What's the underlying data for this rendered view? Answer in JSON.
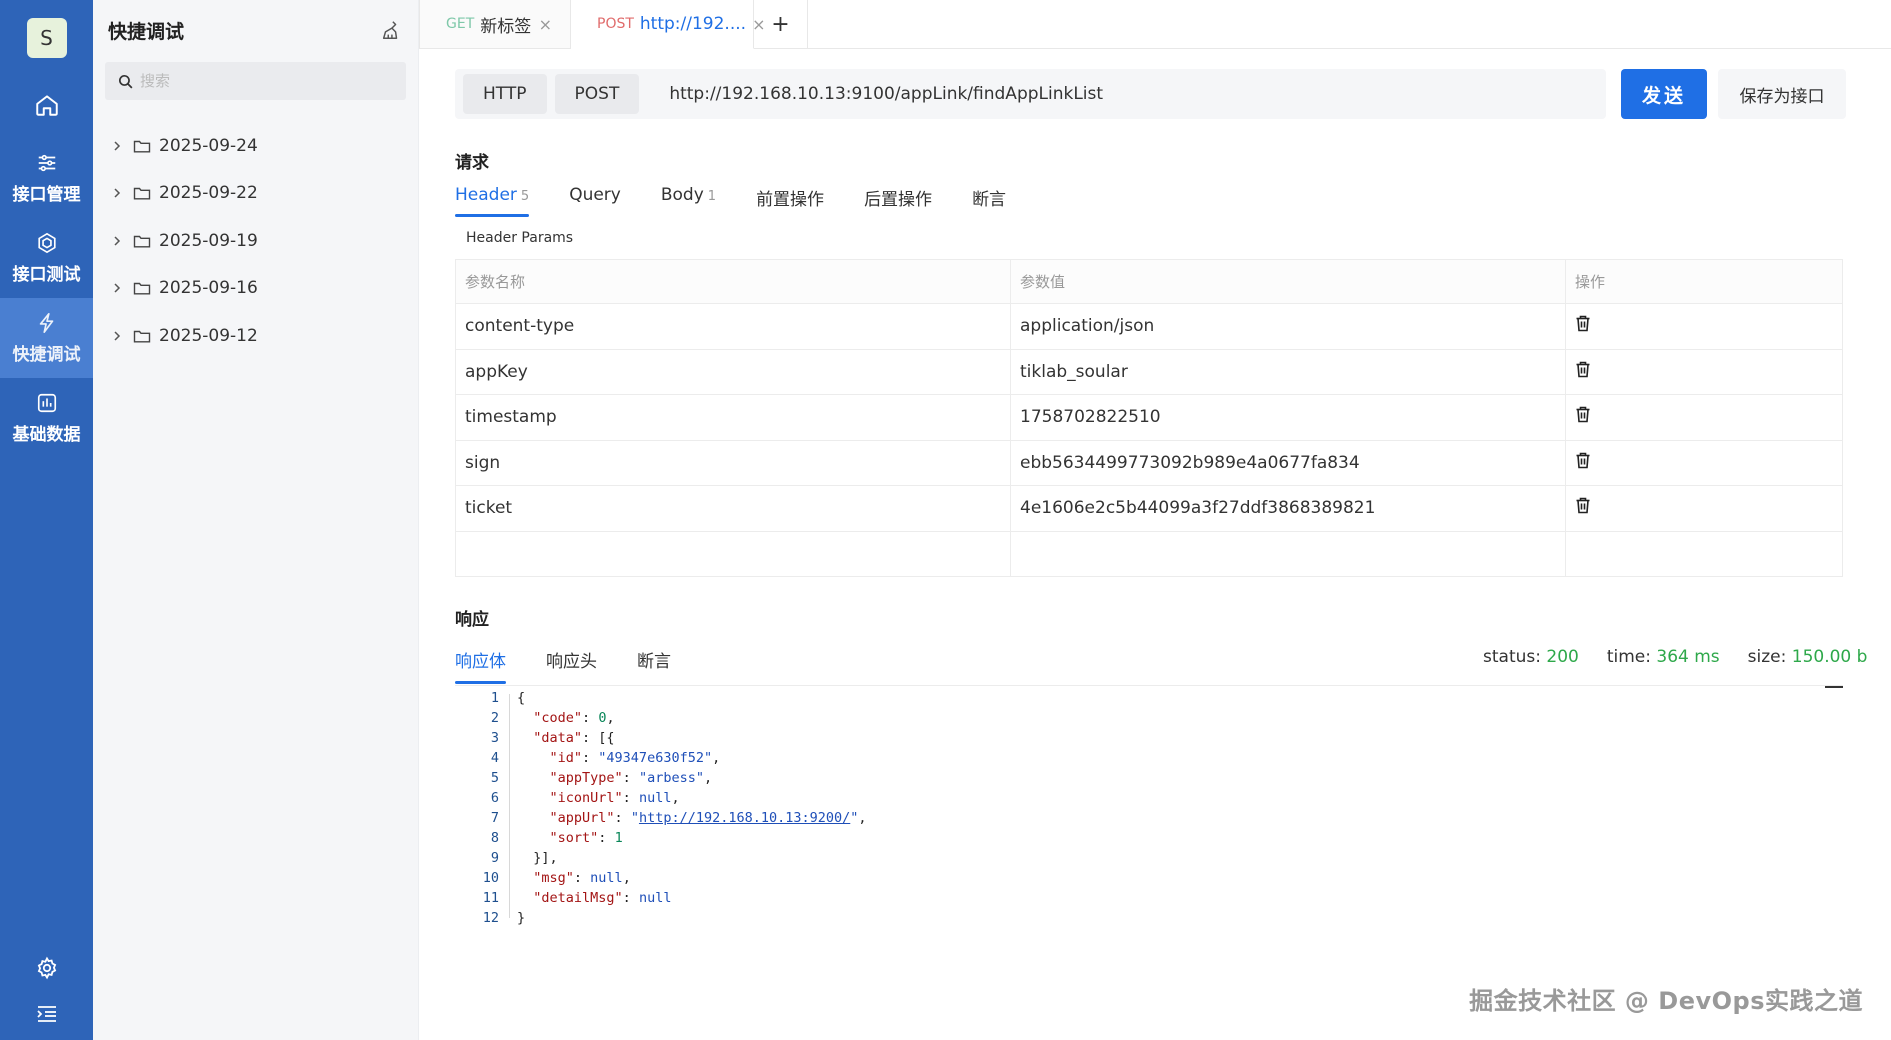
{
  "rail": {
    "avatar_letter": "S",
    "items": [
      {
        "label": "接口管理",
        "icon": "sliders-icon"
      },
      {
        "label": "接口测试",
        "icon": "hexagon-icon"
      },
      {
        "label": "快捷调试",
        "icon": "lightning-icon",
        "active": true
      },
      {
        "label": "基础数据",
        "icon": "chart-box-icon"
      }
    ]
  },
  "tree": {
    "title": "快捷调试",
    "search_placeholder": "搜索",
    "nodes": [
      "2025-09-24",
      "2025-09-22",
      "2025-09-19",
      "2025-09-16",
      "2025-09-12"
    ]
  },
  "tabs": [
    {
      "method": "GET",
      "label": "新标签",
      "close": "×"
    },
    {
      "method": "POST",
      "label": "http://192....",
      "close": "×"
    }
  ],
  "tab_add": "+",
  "request": {
    "protocol": "HTTP",
    "method": "POST",
    "url": "http://192.168.10.13:9100/appLink/findAppLinkList",
    "send_label": "发送",
    "save_label": "保存为接口",
    "section_title": "请求",
    "subtabs": [
      {
        "label": "Header",
        "count": "5",
        "active": true
      },
      {
        "label": "Query",
        "count": ""
      },
      {
        "label": "Body",
        "count": "1"
      },
      {
        "label": "前置操作",
        "count": ""
      },
      {
        "label": "后置操作",
        "count": ""
      },
      {
        "label": "断言",
        "count": ""
      }
    ],
    "params_label": "Header Params",
    "columns": [
      "参数名称",
      "参数值",
      "操作"
    ],
    "rows": [
      {
        "name": "content-type",
        "value": "application/json"
      },
      {
        "name": "appKey",
        "value": "tiklab_soular"
      },
      {
        "name": "timestamp",
        "value": "1758702822510"
      },
      {
        "name": "sign",
        "value": "ebb5634499773092b989e4a0677fa834"
      },
      {
        "name": "ticket",
        "value": "4e1606e2c5b44099a3f27ddf3868389821"
      }
    ]
  },
  "response": {
    "section_title": "响应",
    "subtabs": [
      {
        "label": "响应体",
        "active": true
      },
      {
        "label": "响应头"
      },
      {
        "label": "断言"
      }
    ],
    "status_label": "status:",
    "status": "200",
    "time_label": "time:",
    "time": "364 ms",
    "size_label": "size:",
    "size": "150.00 b",
    "line_numbers": [
      "1",
      "2",
      "3",
      "4",
      "5",
      "6",
      "7",
      "8",
      "9",
      "10",
      "11",
      "12"
    ]
  },
  "watermark": "掘金技术社区 @ DevOps实践之道",
  "colors": {
    "rail": "#2e64b8",
    "accent": "#1f6fe5",
    "success": "#2ea84a"
  }
}
